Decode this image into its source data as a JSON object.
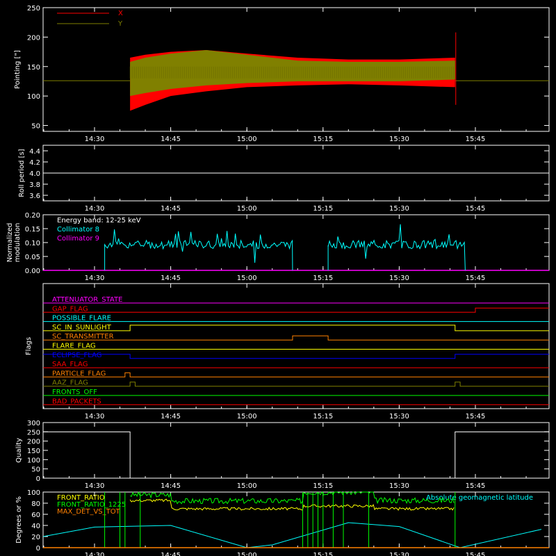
{
  "time_ticks": [
    "14:30",
    "14:45",
    "15:00",
    "15:15",
    "15:30",
    "15:45"
  ],
  "chart_data": [
    {
      "type": "line",
      "panel": "pointing",
      "ylabel": "Pointing [\"]",
      "yticks": [
        "250",
        "200",
        "150",
        "100",
        "50"
      ],
      "ylim": [
        40,
        250
      ],
      "legend": "top-left",
      "series": [
        {
          "name": "X",
          "color": "#ff0000"
        },
        {
          "name": "Y",
          "color": "#808000"
        }
      ],
      "baseline": 126,
      "active_range": [
        "14:37",
        "15:41"
      ],
      "x_envelope": {
        "x": [
          "14:37",
          "14:40",
          "14:45",
          "14:52",
          "15:00",
          "15:10",
          "15:20",
          "15:30",
          "15:41"
        ],
        "upper": [
          165,
          170,
          175,
          178,
          172,
          165,
          162,
          162,
          165
        ],
        "lower": [
          75,
          85,
          100,
          108,
          115,
          118,
          120,
          118,
          115
        ]
      },
      "y_envelope": {
        "x": [
          "14:37",
          "14:40",
          "14:45",
          "14:52",
          "15:00",
          "15:10",
          "15:20",
          "15:30",
          "15:41"
        ],
        "upper": [
          158,
          165,
          172,
          178,
          170,
          160,
          158,
          158,
          160
        ],
        "lower": [
          100,
          105,
          112,
          118,
          122,
          125,
          125,
          125,
          128
        ]
      }
    },
    {
      "type": "line",
      "panel": "roll_period",
      "ylabel": "Roll period [s]",
      "yticks": [
        "4.4",
        "4.2",
        "4.0",
        "3.8",
        "3.6"
      ],
      "ylim": [
        3.5,
        4.5
      ],
      "series": [
        {
          "name": "",
          "values": [
            4.0
          ],
          "color": "#ffffff"
        }
      ]
    },
    {
      "type": "line",
      "panel": "modulation",
      "ylabel_lines": [
        "Normalized",
        "modulation"
      ],
      "yticks": [
        "0.20",
        "0.15",
        "0.10",
        "0.05",
        "0.00"
      ],
      "ylim": [
        0,
        0.2
      ],
      "annotation": "Energy band: 12-25 keV",
      "legend": "top-left",
      "series": [
        {
          "name": "Collimator 8",
          "color": "#00ffff",
          "segments": [
            [
              "14:32",
              "15:09"
            ],
            [
              "15:16",
              "15:43"
            ]
          ],
          "level": 0.09
        },
        {
          "name": "Collimator 9",
          "color": "#ff00ff",
          "level": 0.0
        }
      ]
    },
    {
      "type": "line",
      "panel": "flags",
      "ylabel": "Flags",
      "flags": [
        {
          "name": "ATTENUATOR_STATE",
          "color": "#ff00ff"
        },
        {
          "name": "GAP_FLAG",
          "color": "#ff0000"
        },
        {
          "name": "POSSIBLE_FLARE",
          "color": "#00ffff"
        },
        {
          "name": "SC_IN_SUNLIGHT",
          "color": "#ffff00"
        },
        {
          "name": "SC_TRANSMITTER",
          "color": "#ff8000"
        },
        {
          "name": "FLARE_FLAG",
          "color": "#ffff00"
        },
        {
          "name": "ECLIPSE_FLAG",
          "color": "#0000ff"
        },
        {
          "name": "SAA_FLAG",
          "color": "#ff0000"
        },
        {
          "name": "PARTICLE_FLAG",
          "color": "#ff8000"
        },
        {
          "name": "AAZ_FLAG",
          "color": "#808000"
        },
        {
          "name": "FRONTS_OFF",
          "color": "#00ff00"
        },
        {
          "name": "BAD_PACKETS",
          "color": "#ff0000"
        }
      ]
    },
    {
      "type": "line",
      "panel": "quality",
      "ylabel": "Quality",
      "yticks": [
        "300",
        "250",
        "200",
        "150",
        "100",
        "50",
        "0"
      ],
      "ylim": [
        0,
        300
      ],
      "series": [
        {
          "name": "",
          "color": "#ffffff",
          "x": [
            "14:09",
            "14:37",
            "14:37",
            "15:41",
            "15:41",
            "16:00"
          ],
          "values": [
            250,
            250,
            0,
            0,
            250,
            250
          ]
        }
      ]
    },
    {
      "type": "line",
      "panel": "ratios",
      "ylabel": "Degrees or %",
      "yticks": [
        "100",
        "80",
        "60",
        "40",
        "20",
        "0"
      ],
      "ylim": [
        0,
        100
      ],
      "legend": "top-left",
      "right_label": "Absolute geomagnetic latitude",
      "series": [
        {
          "name": "FRONT_RATIO",
          "color": "#ffff00"
        },
        {
          "name": "FRONT_RATIO_1225",
          "color": "#00ff00"
        },
        {
          "name": "MAX_DET_VS_TOT",
          "color": "#ff8000"
        },
        {
          "name": "Absolute geomagnetic latitude",
          "color": "#00ffff"
        }
      ]
    }
  ]
}
